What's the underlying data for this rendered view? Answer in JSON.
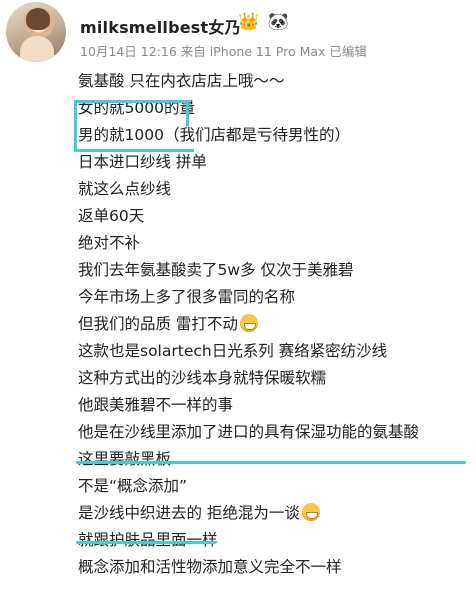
{
  "post": {
    "username": "milksmellbest女乃",
    "badges": [
      "👑",
      "🐼"
    ],
    "meta": "10月14日 12:16 来自 iPhone 11 Pro Max  已编辑",
    "lines": [
      "氨基酸 只在内衣店店上哦～～",
      "女的就5000的量",
      "男的就1000（我们店都是亏待男性的）",
      "日本进口纱线 拼单",
      "就这么点纱线",
      "返单60天",
      "绝对不补",
      "我们去年氨基酸卖了5w多 仅次于美雅碧",
      "今年市场上多了很多雷同的名称",
      "但我们的品质 雷打不动",
      "这款也是solartech日光系列 赛络紧密纺沙线",
      "这种方式出的沙线本身就特保暖软糯",
      "他跟美雅碧不一样的事",
      "他是在沙线里添加了进口的具有保湿功能的氨基酸",
      "这里要敲黑板",
      "不是“概念添加”",
      "是沙线中织进去的 拒绝混为一谈",
      "就跟护肤品里面一样",
      "概念添加和活性物添加意义完全不一样"
    ]
  }
}
